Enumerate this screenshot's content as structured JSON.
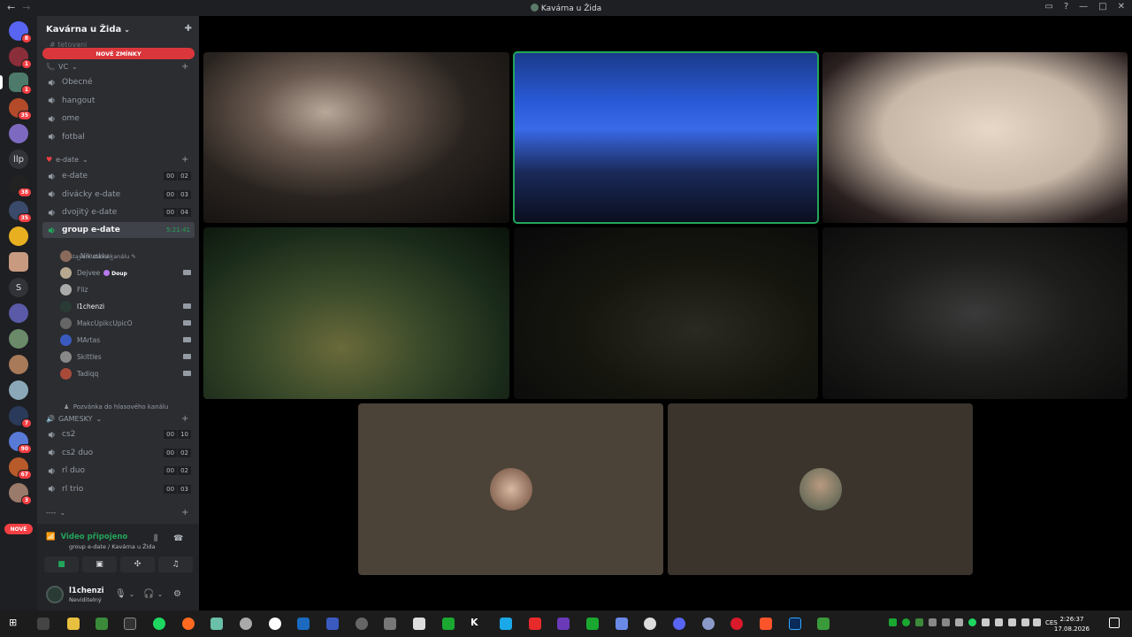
{
  "window": {
    "title": "Kavárna u Žida"
  },
  "server": {
    "name": "Kavárna u Žida",
    "mention_pill": "NOVÉ ZMÍNKY",
    "scrolled_channel": "tetovani"
  },
  "guild_badges": {
    "g1": "8",
    "g2": "1",
    "g3": "1",
    "g4": "35",
    "g5": "38",
    "g6": "35",
    "g7": "7",
    "g8": "90",
    "g9": "67",
    "g10": "3",
    "nove": "NOVÉ"
  },
  "guild_text": {
    "llp": "llp",
    "s": "S"
  },
  "categories": {
    "vc": "VC",
    "edate": "e-date",
    "gamesky": "GAMESKY",
    "dash": "----"
  },
  "channels_vc": [
    {
      "name": "Obecné"
    },
    {
      "name": "hangout"
    },
    {
      "name": "ome"
    },
    {
      "name": "fotbal"
    }
  ],
  "channels_edate": [
    {
      "name": "e-date",
      "c1": "00",
      "c2": "02"
    },
    {
      "name": "divácky e-date",
      "c1": "00",
      "c2": "03"
    },
    {
      "name": "dvojitý e-date",
      "c1": "00",
      "c2": "04"
    }
  ],
  "active_channel": {
    "name": "group e-date",
    "time": "5:21:41",
    "status": "Nastavení stavu kanálu"
  },
  "members": [
    {
      "name": "_Nikuskka_"
    },
    {
      "name": "Dejvee",
      "tag": "Doup"
    },
    {
      "name": "Fliz"
    },
    {
      "name": "l1chenzi"
    },
    {
      "name": "MakcUpikcUpicO"
    },
    {
      "name": "MArtas"
    },
    {
      "name": "Skittles"
    },
    {
      "name": "Tadiqq"
    }
  ],
  "invite": "Pozvánka do hlasového kanálu",
  "channels_gamesky": [
    {
      "name": "cs2",
      "c1": "00",
      "c2": "10"
    },
    {
      "name": "cs2 duo",
      "c1": "00",
      "c2": "02"
    },
    {
      "name": "rl duo",
      "c1": "00",
      "c2": "02"
    },
    {
      "name": "rl trio",
      "c1": "00",
      "c2": "03"
    }
  ],
  "voice": {
    "status": "Video připojeno",
    "location": "group e-date / Kavárna u Žida"
  },
  "user": {
    "name": "l1chenzi",
    "status": "Neviditelný"
  },
  "taskbar": {
    "time": "2:26:37",
    "date": "17.08.2026",
    "lang": "CES"
  },
  "colors": {
    "online": "#23a55a",
    "mention": "#da373c",
    "sidebar": "#2b2d31",
    "rail": "#1e1f22"
  }
}
